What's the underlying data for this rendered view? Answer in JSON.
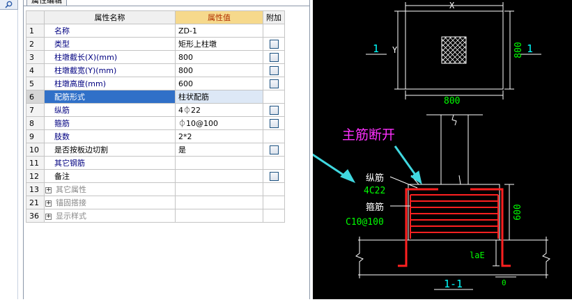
{
  "panel": {
    "tab_label": "属性编辑",
    "columns": {
      "name": "属性名称",
      "value": "属性值",
      "add": "附加"
    },
    "rows": [
      {
        "num": "1",
        "name": "名称",
        "value": "ZD-1",
        "checkbox": false
      },
      {
        "num": "2",
        "name": "类型",
        "value": "矩形上柱墩",
        "checkbox": true
      },
      {
        "num": "3",
        "name": "柱墩截长(X)(mm)",
        "value": "800",
        "checkbox": true
      },
      {
        "num": "4",
        "name": "柱墩截宽(Y)(mm)",
        "value": "800",
        "checkbox": true
      },
      {
        "num": "5",
        "name": "柱墩高度(mm)",
        "value": "600",
        "checkbox": true
      },
      {
        "num": "6",
        "name": "配筋形式",
        "value": "柱状配筋",
        "checkbox": false,
        "selected": true
      },
      {
        "num": "7",
        "name": "纵筋",
        "value": "4⏀22",
        "checkbox": true
      },
      {
        "num": "8",
        "name": "箍筋",
        "value": "⏀10@100",
        "checkbox": true
      },
      {
        "num": "9",
        "name": "肢数",
        "value": "2*2",
        "checkbox": false
      },
      {
        "num": "10",
        "name": "是否按板边切割",
        "value": "是",
        "checkbox": true,
        "black": true
      },
      {
        "num": "11",
        "name": "其它钢筋",
        "value": "",
        "checkbox": false
      },
      {
        "num": "12",
        "name": "备注",
        "value": "",
        "checkbox": true,
        "black": true
      },
      {
        "num": "13",
        "name": "其它属性",
        "value": "",
        "checkbox": false,
        "group": true
      },
      {
        "num": "21",
        "name": "锚固搭接",
        "value": "",
        "checkbox": false,
        "group": true
      },
      {
        "num": "36",
        "name": "显示样式",
        "value": "",
        "checkbox": false,
        "group": true
      }
    ]
  },
  "drawing": {
    "plan_x_label": "X",
    "plan_y_label": "Y",
    "plan_width_dim": "800",
    "plan_height_dim": "800",
    "section_mark_left": "1",
    "section_mark_right": "1",
    "annotation": "主筋断开",
    "long_bar_label": "纵筋",
    "long_bar_value": "4C22",
    "stirrup_label": "箍筋",
    "stirrup_value": "C10@100",
    "height_dim": "600",
    "anchor_label": "laE",
    "zero_dim": "0",
    "section_title": "1-1"
  },
  "colors": {
    "selected_row": "#3070c8",
    "header_value": "#f6d98c",
    "cad_background": "#000000",
    "rebar": "#ff2020",
    "dimension": "#00ff00",
    "annotation": "#ff30ff",
    "arrow": "#40d8e0"
  }
}
